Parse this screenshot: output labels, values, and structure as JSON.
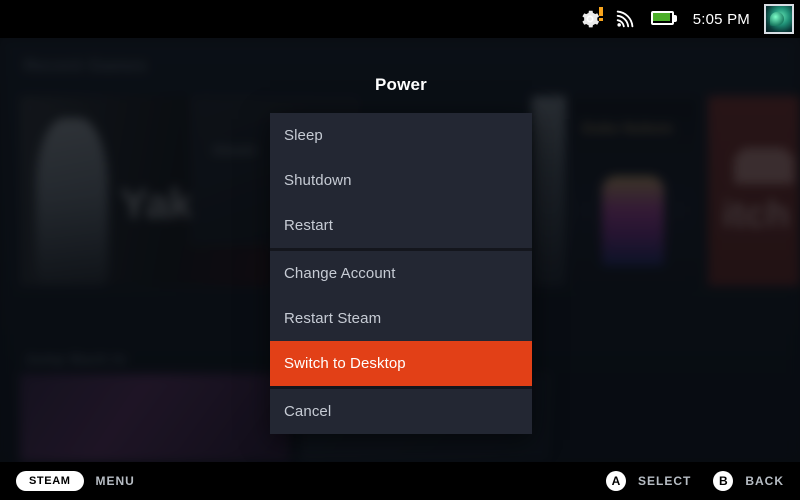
{
  "status_bar": {
    "gear_icon": "gear-icon",
    "gear_badge": "alert-badge",
    "wifi_icon": "wifi-icon",
    "battery_icon": "battery-icon",
    "clock": "5:05 PM",
    "avatar": "user-avatar"
  },
  "background": {
    "heading_recent": "Recent Games",
    "heading_secondary": "Jump Back In",
    "tiles": [
      {
        "label": "Yakuza"
      },
      {
        "label": "Steam"
      },
      {
        "label": "Duke Nukem"
      },
      {
        "label": "itch"
      }
    ]
  },
  "power_menu": {
    "title": "Power",
    "groups": [
      {
        "items": [
          {
            "label": "Sleep",
            "selected": false
          },
          {
            "label": "Shutdown",
            "selected": false
          },
          {
            "label": "Restart",
            "selected": false
          }
        ]
      },
      {
        "items": [
          {
            "label": "Change Account",
            "selected": false
          },
          {
            "label": "Restart Steam",
            "selected": false
          },
          {
            "label": "Switch to Desktop",
            "selected": true
          }
        ]
      },
      {
        "items": [
          {
            "label": "Cancel",
            "selected": false
          }
        ]
      }
    ]
  },
  "bottom_bar": {
    "steam_pill": "STEAM",
    "menu_label": "MENU",
    "select_button": "A",
    "select_label": "SELECT",
    "back_button": "B",
    "back_label": "BACK"
  },
  "colors": {
    "accent": "#e24017",
    "menu_bg": "#232733",
    "bar_bg": "#000000",
    "battery_green": "#4caf2a",
    "badge_orange": "#f7a41d"
  }
}
